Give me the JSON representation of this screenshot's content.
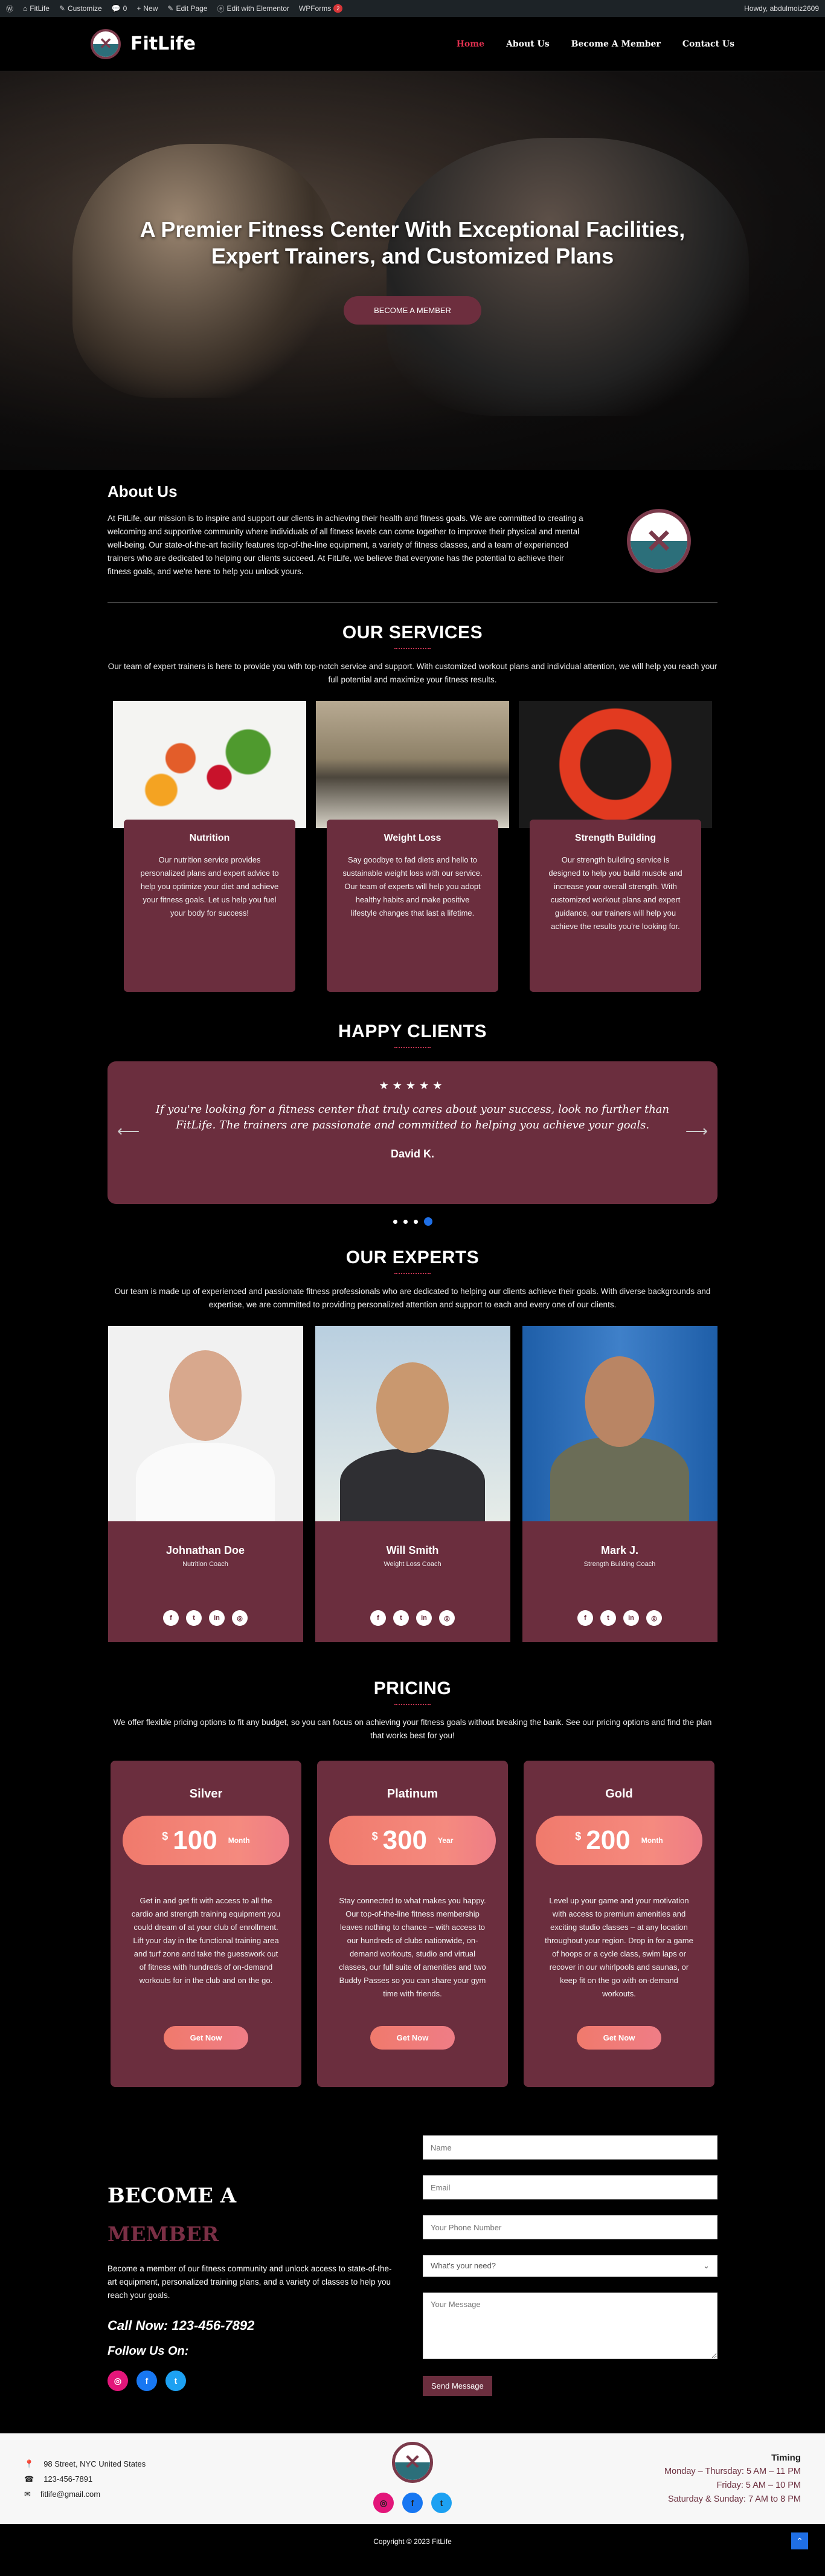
{
  "adminbar": {
    "items": [
      "FitLife",
      "Customize",
      "0",
      "New",
      "Edit Page",
      "Edit with Elementor",
      "WPForms"
    ],
    "wpforms_badge": "2",
    "howdy": "Howdy, abdulmoiz2609"
  },
  "header": {
    "brand": "FitLife",
    "nav": [
      "Home",
      "About Us",
      "Become A Member",
      "Contact Us"
    ]
  },
  "hero": {
    "title": "A Premier Fitness Center With Exceptional Facilities, Expert Trainers, and Customized Plans",
    "cta": "BECOME A MEMBER"
  },
  "about": {
    "title": "About Us",
    "text": "At FitLife, our mission is to inspire and support our clients in achieving their health and fitness goals. We are committed to creating a welcoming and supportive community where individuals of all fitness levels can come together to improve their physical and mental well-being. Our state-of-the-art facility features top-of-the-line equipment, a variety of fitness classes, and a team of experienced trainers who are dedicated to helping our clients succeed. At FitLife, we believe that everyone has the potential to achieve their fitness goals, and we're here to help you unlock yours."
  },
  "services": {
    "title": "OUR SERVICES",
    "desc": "Our team of expert trainers is here to provide you with top-notch service and support. With customized workout plans and individual attention, we will help you reach your full potential and maximize your fitness results.",
    "items": [
      {
        "title": "Nutrition",
        "text": "Our nutrition service provides personalized plans and expert advice to help you optimize your diet and achieve your fitness goals. Let us help you fuel your body for success!"
      },
      {
        "title": "Weight Loss",
        "text": "Say goodbye to fad diets and hello to sustainable weight loss with our service. Our team of experts will help you adopt healthy habits and make positive lifestyle changes that last a lifetime."
      },
      {
        "title": "Strength Building",
        "text": "Our strength building service is designed to help you build muscle and increase your overall strength. With customized workout plans and expert guidance, our trainers will help you achieve the results you're looking for."
      }
    ]
  },
  "clients": {
    "title": "HAPPY CLIENTS",
    "stars": "★★★★★",
    "quote": "If you're looking for a fitness center that truly cares about your success, look no further than FitLife. The trainers are passionate and committed to helping you achieve your goals.",
    "author": "David K.",
    "prev": "⟵",
    "next": "⟶"
  },
  "experts": {
    "title": "OUR EXPERTS",
    "desc": "Our team is made up of experienced and passionate fitness professionals who are dedicated to helping our clients achieve their goals. With diverse backgrounds and expertise, we are committed to providing personalized attention and support to each and every one of our clients.",
    "people": [
      {
        "name": "Johnathan Doe",
        "role": "Nutrition Coach"
      },
      {
        "name": "Will Smith",
        "role": "Weight Loss Coach"
      },
      {
        "name": "Mark J.",
        "role": "Strength Building Coach"
      }
    ],
    "social_glyphs": [
      "f",
      "t",
      "in",
      "◎"
    ]
  },
  "pricing": {
    "title": "PRICING",
    "desc": "We offer flexible pricing options to fit any budget, so you can focus on achieving your fitness goals without breaking the bank. See our pricing options and find the plan that works best for you!",
    "plans": [
      {
        "name": "Silver",
        "currency": "$",
        "amount": "100",
        "period": "Month",
        "text": "Get in and get fit with access to all the cardio and strength training equipment you could dream of at your club of enrollment. Lift your day in the functional training area and turf zone and take the guesswork out of fitness with hundreds of on-demand workouts for in the club and on the go.",
        "button": "Get Now"
      },
      {
        "name": "Platinum",
        "currency": "$",
        "amount": "300",
        "period": "Year",
        "text": "Stay connected to what makes you happy. Our top-of-the-line fitness membership leaves nothing to chance – with access to our hundreds of clubs nationwide, on-demand workouts, studio and virtual classes, our full suite of amenities and two Buddy Passes so you can share your gym time with friends.",
        "button": "Get Now"
      },
      {
        "name": "Gold",
        "currency": "$",
        "amount": "200",
        "period": "Month",
        "text": "Level up your game and your motivation with access to premium amenities and exciting studio classes – at any location throughout your region. Drop in for a game of hoops or a cycle class, swim laps or recover in our whirlpools and saunas, or keep fit on the go with on-demand workouts.",
        "button": "Get Now"
      }
    ]
  },
  "contact": {
    "title1": "BECOME A",
    "title2": "MEMBER",
    "text": "Become a member of our fitness community and unlock access to state-of-the-art equipment, personalized training plans, and a variety of classes to help you reach your goals.",
    "call": "Call Now: 123-456-7892",
    "follow": "Follow Us On:",
    "form": {
      "name": "Name",
      "email": "Email",
      "phone": "Your Phone Number",
      "need": "What's your need?",
      "message": "Your Message",
      "send": "Send Message"
    }
  },
  "footer": {
    "address": "98 Street, NYC United States",
    "phone": "123-456-7891",
    "email": "fitlife@gmail.com",
    "timing_title": "Timing",
    "timing": [
      "Monday – Thursday: 5 AM – 11 PM",
      "Friday: 5 AM – 10 PM",
      "Saturday & Sunday: 7 AM to 8 PM"
    ],
    "copyright": "Copyright © 2023 FitLife"
  }
}
